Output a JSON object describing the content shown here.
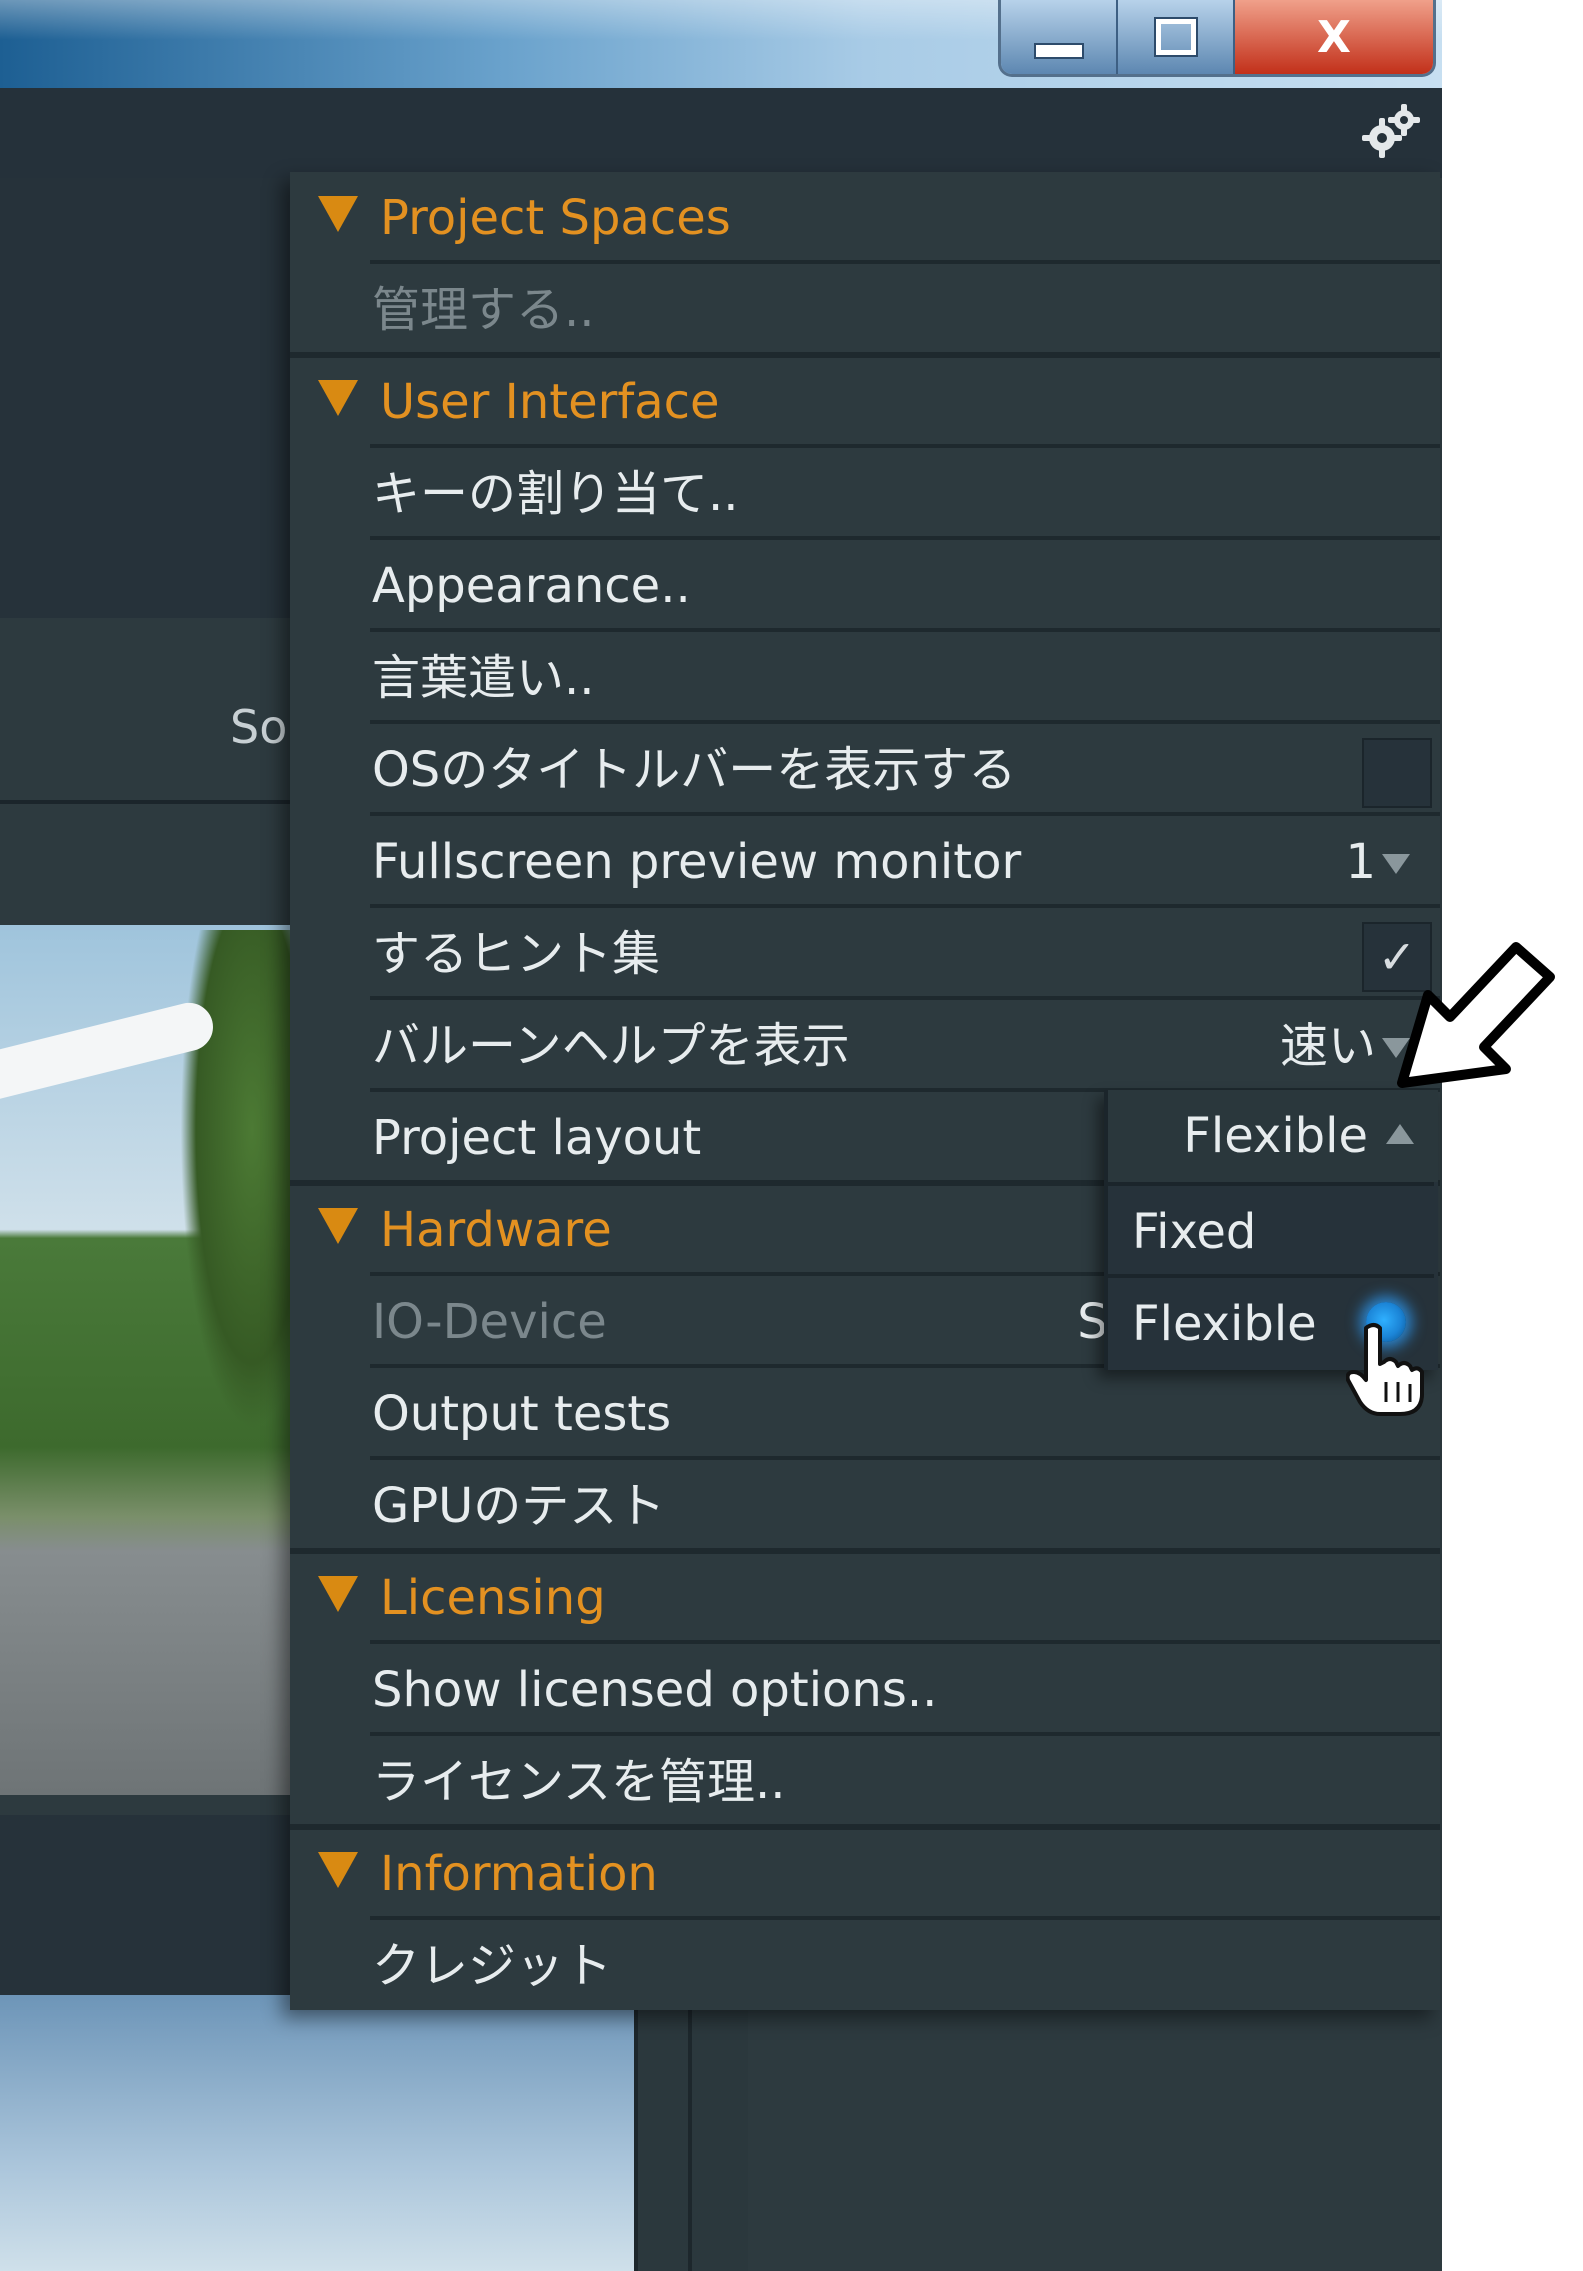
{
  "window": {
    "close_glyph": "X"
  },
  "background": {
    "source_label": "So"
  },
  "menu": {
    "sections": [
      {
        "header": "Project Spaces",
        "items": [
          {
            "label": "管理する..",
            "disabled": true
          }
        ]
      },
      {
        "header": "User Interface",
        "items": [
          {
            "label": "キーの割り当て.."
          },
          {
            "label": "Appearance.."
          },
          {
            "label": "言葉遣い.."
          },
          {
            "label": "OSのタイトルバーを表示する",
            "checkbox": false
          },
          {
            "label": "Fullscreen preview monitor",
            "value": "1"
          },
          {
            "label": "するヒント集",
            "checkbox": true,
            "check_mark": "✓"
          },
          {
            "label": "バルーンヘルプを表示",
            "value": "速い"
          },
          {
            "label": "Project layout",
            "value": "Flexible"
          }
        ]
      },
      {
        "header": "Hardware",
        "items": [
          {
            "label": "IO-Device",
            "disabled": true,
            "value": "Syst"
          },
          {
            "label": "Output tests"
          },
          {
            "label": "GPUのテスト"
          }
        ]
      },
      {
        "header": "Licensing",
        "items": [
          {
            "label": "Show licensed options.."
          },
          {
            "label": "ライセンスを管理.."
          }
        ]
      },
      {
        "header": "Information",
        "items": [
          {
            "label": "クレジット"
          }
        ]
      }
    ]
  },
  "dropdown": {
    "selected": "Flexible",
    "options": [
      "Fixed",
      "Flexible"
    ],
    "highlighted": "Flexible"
  },
  "colors": {
    "header_text": "#e39121",
    "menu_bg": "#2d3a3f",
    "item_text": "#e7ecee",
    "radio_active": "#1b84d6"
  },
  "icons": {
    "settings": "gear-icon",
    "section_expand": "triangle-down-icon",
    "cursor": "hand-pointer-icon",
    "annotation": "arrow-icon"
  }
}
